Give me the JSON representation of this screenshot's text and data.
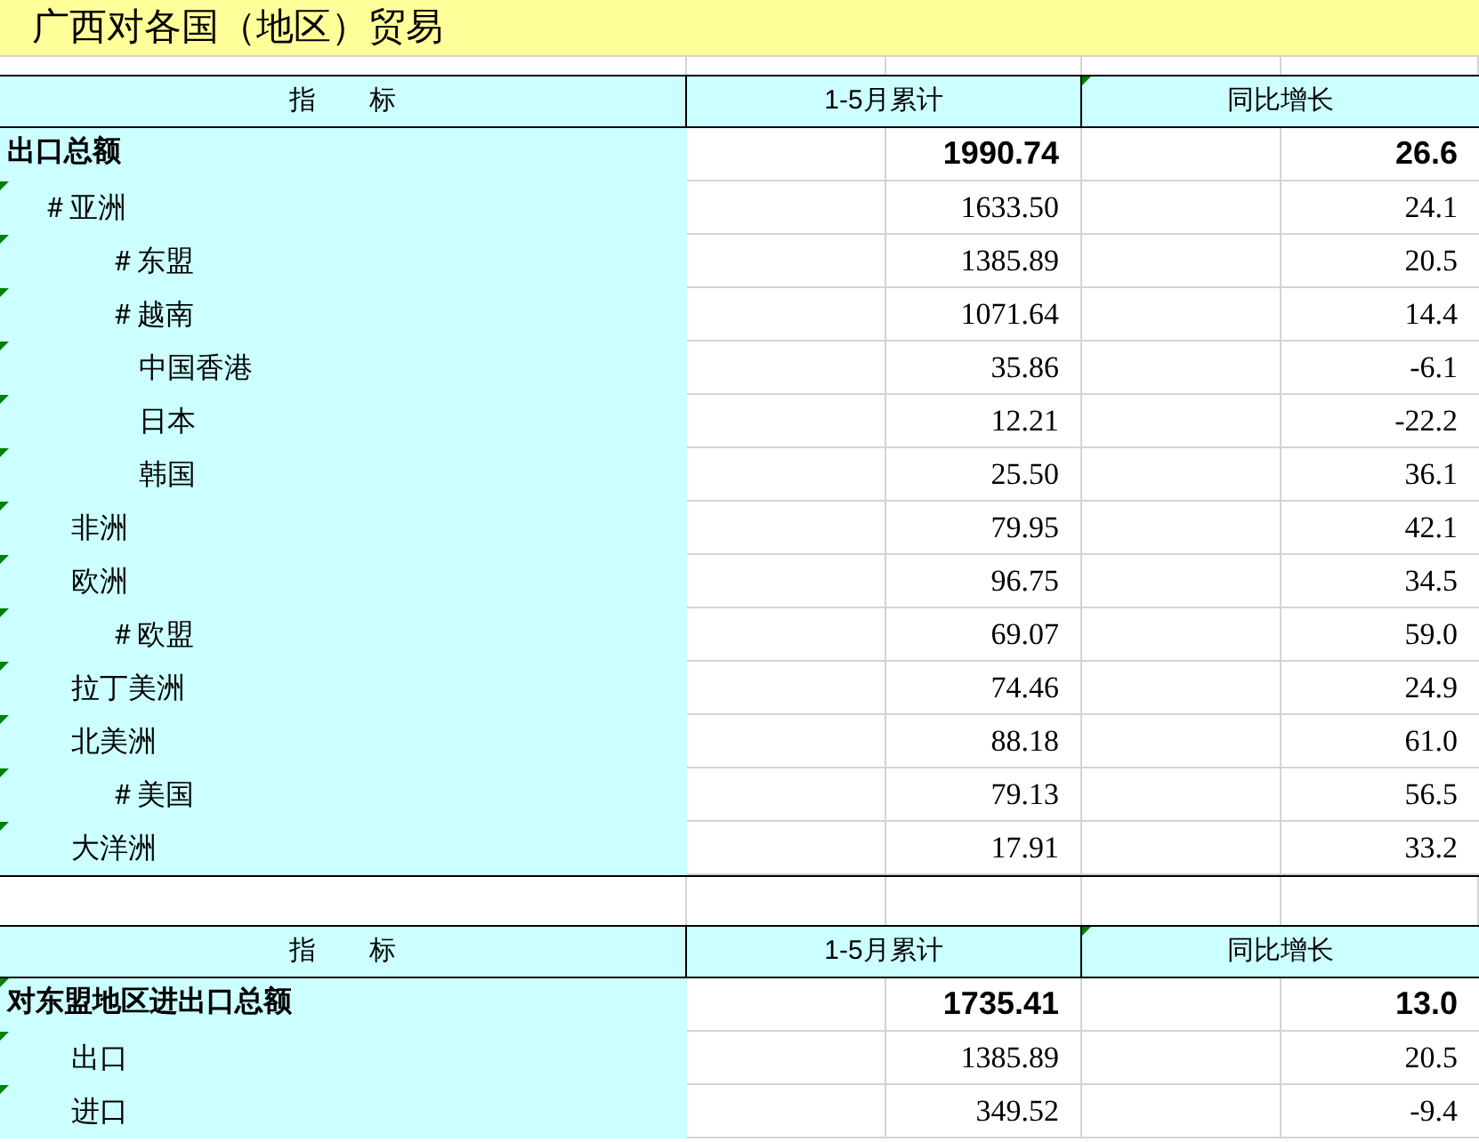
{
  "title": "广西对各国（地区）贸易",
  "sections": [
    {
      "header": {
        "indicator": "指　　标",
        "cumulative": "1-5月累计",
        "yoy": "同比增长"
      },
      "rows": [
        {
          "label": "出口总额",
          "bold": true,
          "marker": false,
          "hanging": false,
          "value": "1990.74",
          "growth": "26.6",
          "children": [
            {
              "label": "＃亚洲",
              "bold": false,
              "marker": true,
              "hanging": true,
              "value": "1633.50",
              "growth": "24.1",
              "children": [
                {
                  "label": "＃东盟",
                  "bold": false,
                  "marker": true,
                  "hanging": true,
                  "value": "1385.89",
                  "growth": "20.5"
                },
                {
                  "label": "＃越南",
                  "bold": false,
                  "marker": true,
                  "hanging": true,
                  "value": "1071.64",
                  "growth": "14.4"
                },
                {
                  "label": "中国香港",
                  "bold": false,
                  "marker": true,
                  "hanging": false,
                  "value": "35.86",
                  "growth": "-6.1"
                },
                {
                  "label": "日本",
                  "bold": false,
                  "marker": true,
                  "hanging": false,
                  "value": "12.21",
                  "growth": "-22.2"
                },
                {
                  "label": "韩国",
                  "bold": false,
                  "marker": true,
                  "hanging": false,
                  "value": "25.50",
                  "growth": "36.1"
                }
              ]
            },
            {
              "label": "非洲",
              "bold": false,
              "marker": true,
              "hanging": false,
              "value": "79.95",
              "growth": "42.1"
            },
            {
              "label": "欧洲",
              "bold": false,
              "marker": true,
              "hanging": false,
              "value": "96.75",
              "growth": "34.5",
              "children": [
                {
                  "label": "＃欧盟",
                  "bold": false,
                  "marker": true,
                  "hanging": true,
                  "value": "69.07",
                  "growth": "59.0"
                }
              ]
            },
            {
              "label": "拉丁美洲",
              "bold": false,
              "marker": true,
              "hanging": false,
              "value": "74.46",
              "growth": "24.9"
            },
            {
              "label": "北美洲",
              "bold": false,
              "marker": true,
              "hanging": false,
              "value": "88.18",
              "growth": "61.0",
              "children": [
                {
                  "label": "＃美国",
                  "bold": false,
                  "marker": true,
                  "hanging": true,
                  "value": "79.13",
                  "growth": "56.5"
                }
              ]
            },
            {
              "label": "大洋洲",
              "bold": false,
              "marker": true,
              "hanging": false,
              "value": "17.91",
              "growth": "33.2"
            }
          ]
        }
      ]
    },
    {
      "header": {
        "indicator": "指　　标",
        "cumulative": "1-5月累计",
        "yoy": "同比增长"
      },
      "rows": [
        {
          "label": "对东盟地区进出口总额",
          "bold": true,
          "marker": true,
          "hanging": false,
          "value": "1735.41",
          "growth": "13.0",
          "children": [
            {
              "label": "出口",
              "bold": false,
              "marker": true,
              "hanging": false,
              "value": "1385.89",
              "growth": "20.5"
            },
            {
              "label": "进口",
              "bold": false,
              "marker": true,
              "hanging": false,
              "value": "349.52",
              "growth": "-9.4"
            }
          ]
        }
      ]
    }
  ]
}
